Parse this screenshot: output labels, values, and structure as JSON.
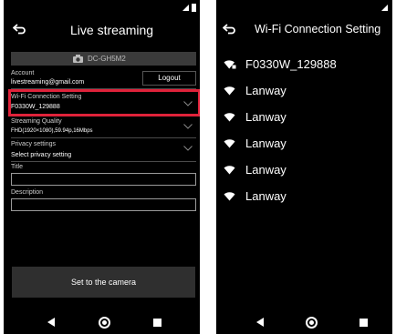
{
  "left_screen": {
    "title": "Live streaming",
    "camera_name": "DC-GH5M2",
    "account_label": "Account",
    "account_value": "livestreaming@gmail.com",
    "logout_label": "Logout",
    "wifi_label": "Wi-Fi Connection Setting",
    "wifi_value": "F0330W_129888",
    "quality_label": "Streaming Quality",
    "quality_value": "FHD(1920×1080),59.94p,16Mbps",
    "privacy_label": "Privacy settings",
    "privacy_value": "Select privacy setting",
    "title_field_label": "Title",
    "title_field_value": "",
    "description_label": "Description",
    "description_value": "",
    "set_button_label": "Set to the camera"
  },
  "right_screen": {
    "title": "Wi-Fi Connection Setting",
    "networks": [
      {
        "name": "F0330W_129888",
        "icon": "wifi-locked-icon"
      },
      {
        "name": "Lanway",
        "icon": "wifi-icon"
      },
      {
        "name": "Lanway",
        "icon": "wifi-icon"
      },
      {
        "name": "Lanway",
        "icon": "wifi-icon"
      },
      {
        "name": "Lanway",
        "icon": "wifi-icon"
      },
      {
        "name": "Lanway",
        "icon": "wifi-icon"
      }
    ]
  },
  "colors": {
    "background": "#000000",
    "highlight": "#e0223a",
    "camera_bar": "#3a3a3a",
    "set_button": "#2f2f2f"
  },
  "icons": [
    "back-arrow-icon",
    "camera-icon",
    "chevron-down-icon",
    "wifi-icon",
    "nav-back-icon",
    "nav-home-icon",
    "nav-recents-icon",
    "signal-icon",
    "battery-icon"
  ]
}
